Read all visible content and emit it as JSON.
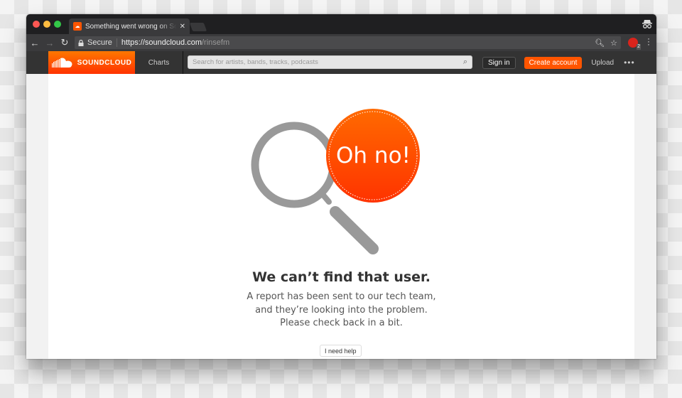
{
  "browser": {
    "tab": {
      "title": "Something went wrong on SoundCloud",
      "favicon": "soundcloud-favicon"
    },
    "address_bar": {
      "secure_label": "Secure",
      "url_host": "https://soundcloud.com",
      "url_path": "/rinsefm"
    },
    "extension_badge": "2",
    "icons": {
      "back": "←",
      "forward": "→",
      "reload": "↻",
      "zoom": "⚲",
      "bookmark": "☆",
      "menu": "⋮",
      "close_tab": "✕"
    }
  },
  "header": {
    "logo_text": "SOUNDCLOUD",
    "nav_charts": "Charts",
    "search_placeholder": "Search for artists, bands, tracks, podcasts",
    "sign_in": "Sign in",
    "create_account": "Create account",
    "upload": "Upload",
    "more": "•••",
    "accent_color": "#ff5500"
  },
  "error": {
    "badge_text": "Oh no!",
    "headline": "We can’t find that user.",
    "lines": [
      "A report has been sent to our tech team,",
      "and they’re looking into the problem.",
      "Please check back in a bit."
    ],
    "help_button": "I need help"
  }
}
